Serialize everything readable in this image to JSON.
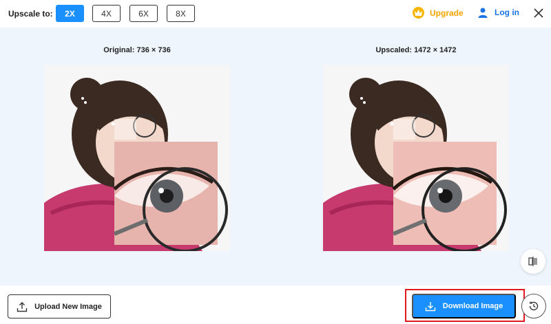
{
  "toolbar": {
    "upscale_label": "Upscale to:",
    "scale_options": [
      "2X",
      "4X",
      "6X",
      "8X"
    ],
    "selected_scale": "2X",
    "upgrade_label": "Upgrade",
    "login_label": "Log in"
  },
  "preview": {
    "original_caption": "Original: 736 × 736",
    "upscaled_caption": "Upscaled: 1472 × 1472"
  },
  "actions": {
    "upload_label": "Upload New Image",
    "download_label": "Download Image"
  },
  "colors": {
    "accent": "#1a90ff",
    "upgrade": "#f5a400",
    "login": "#1a74e8",
    "highlight": "#e3171e"
  },
  "icons": [
    "crown-icon",
    "user-icon",
    "close-icon",
    "compare-icon",
    "upload-icon",
    "download-icon",
    "history-icon"
  ]
}
